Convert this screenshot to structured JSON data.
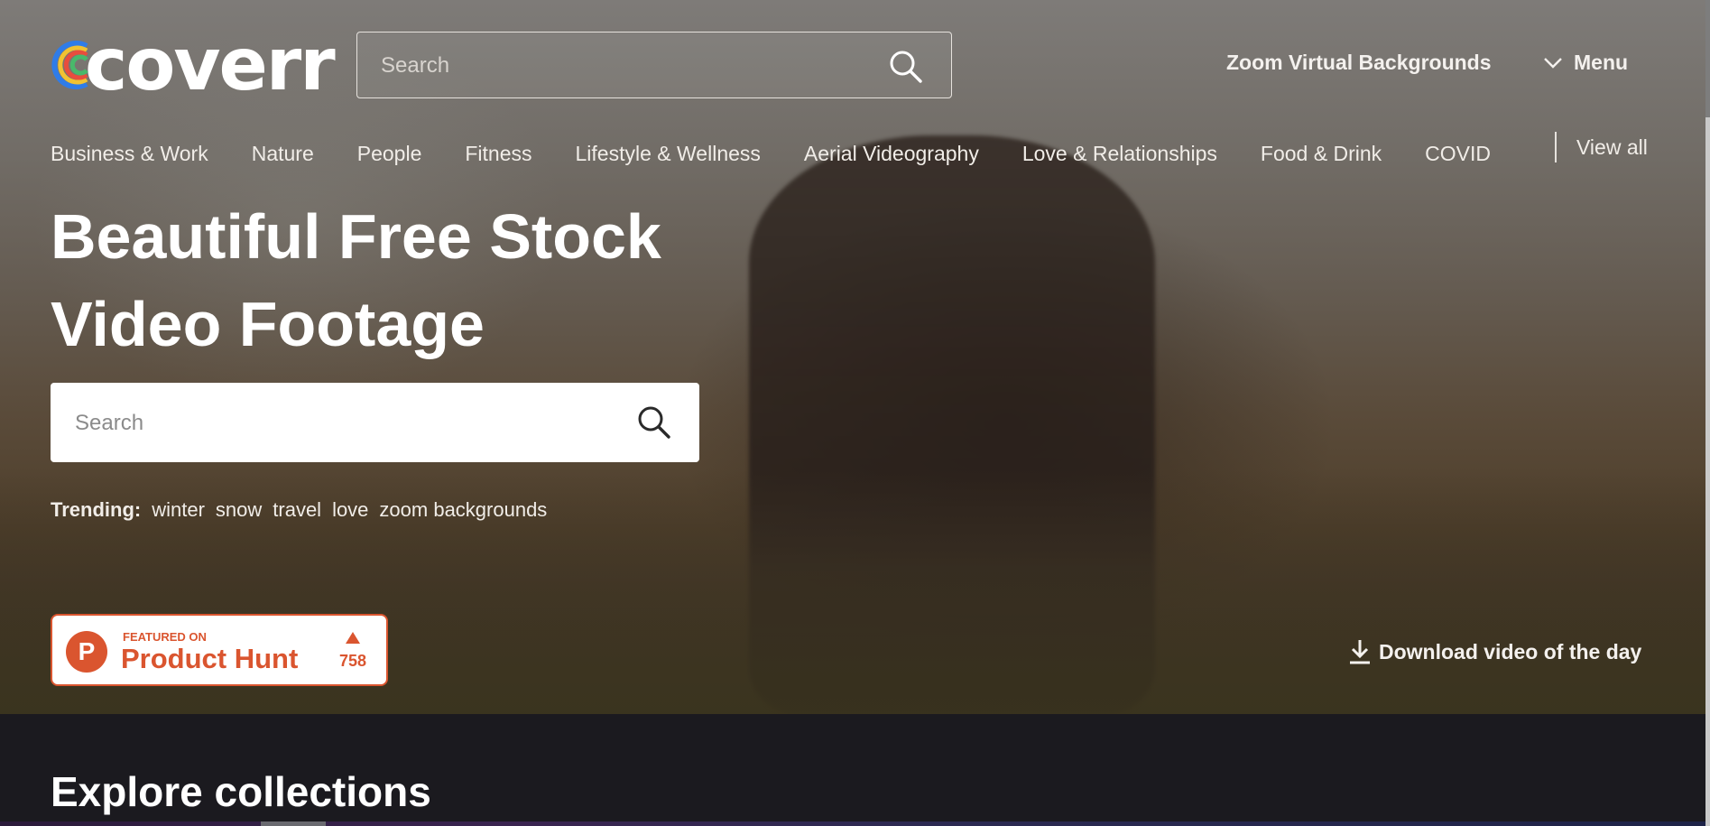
{
  "header": {
    "logo_text": "coverr",
    "search_placeholder": "Search",
    "zoom_link": "Zoom Virtual Backgrounds",
    "menu_label": "Menu"
  },
  "categories": {
    "items": [
      "Business & Work",
      "Nature",
      "People",
      "Fitness",
      "Lifestyle & Wellness",
      "Aerial Videography",
      "Love & Relationships",
      "Food & Drink",
      "COVID"
    ],
    "view_all": "View all"
  },
  "hero": {
    "title_line1": "Beautiful Free Stock",
    "title_line2": "Video Footage",
    "search_placeholder": "Search",
    "trending_label": "Trending:",
    "trending_tags": [
      "winter",
      "snow",
      "travel",
      "love",
      "zoom backgrounds"
    ]
  },
  "product_hunt": {
    "featured": "FEATURED ON",
    "name": "Product Hunt",
    "votes": "758",
    "brand_color": "#da552f"
  },
  "download_link": "Download video of the day",
  "explore": {
    "title": "Explore collections"
  },
  "icons": {
    "header_search": "search-icon",
    "menu": "chevron-down-icon",
    "download": "download-icon",
    "product_hunt": "product-hunt-logo-icon"
  }
}
